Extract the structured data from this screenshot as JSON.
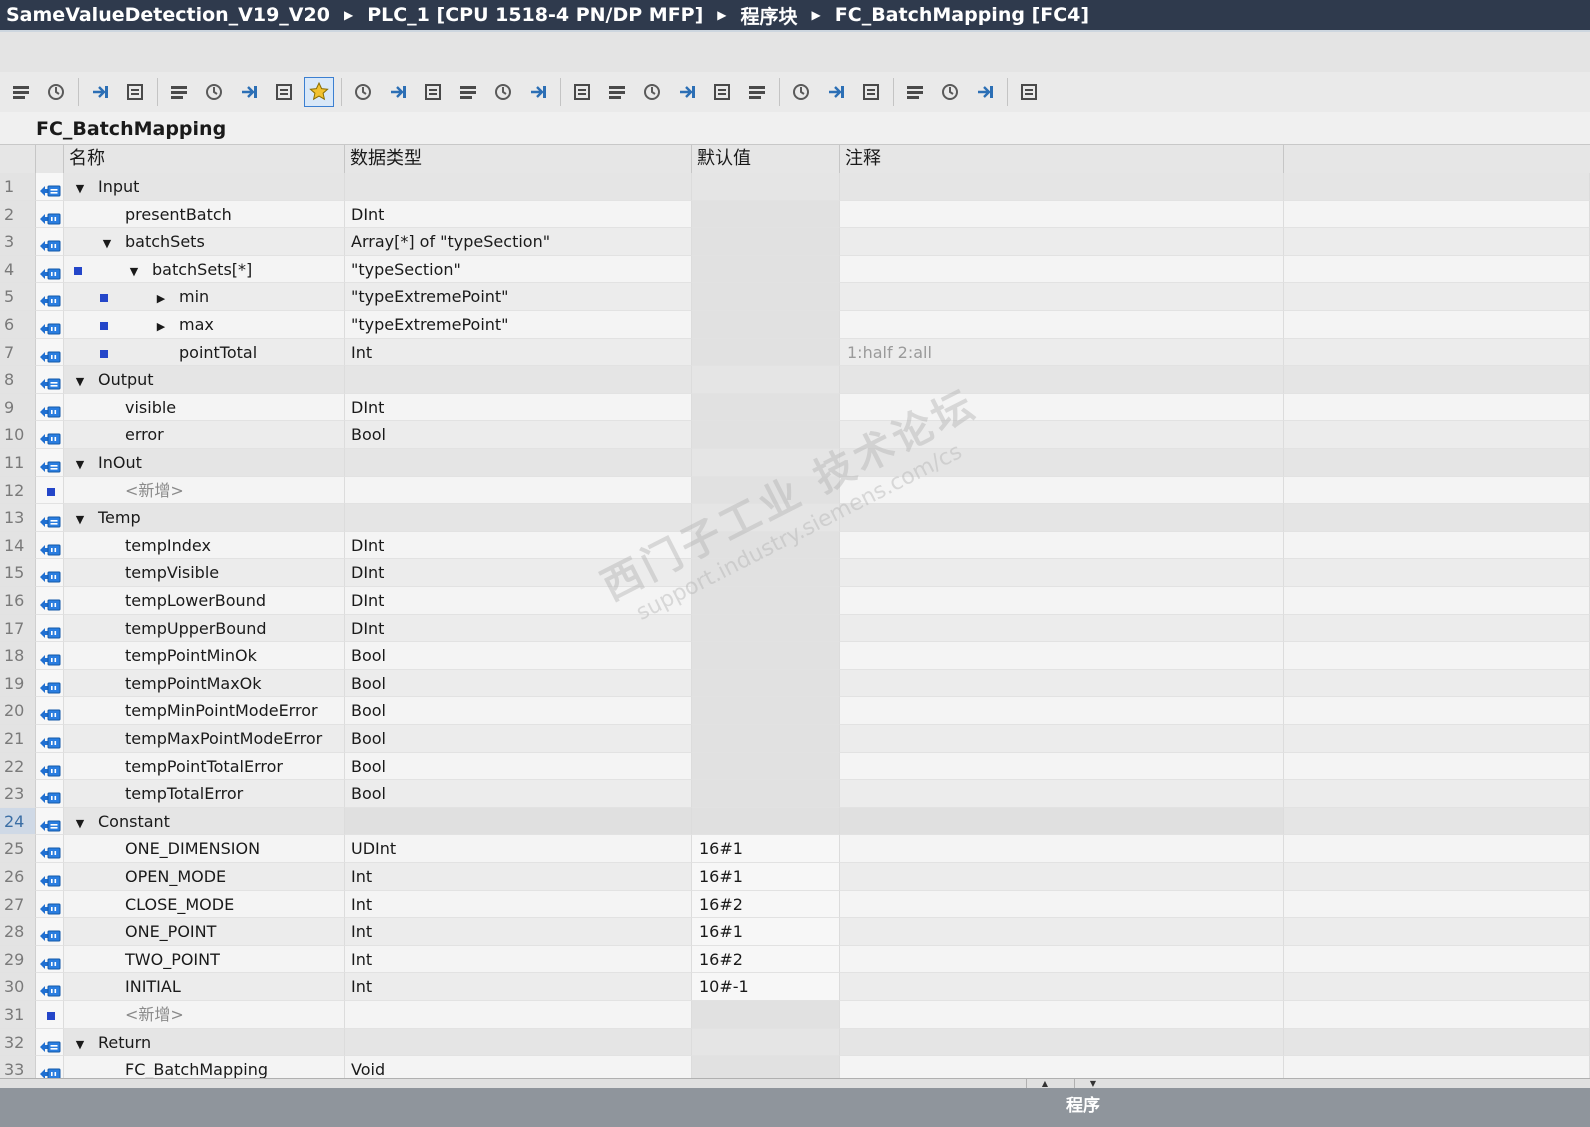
{
  "breadcrumb": [
    "SameValueDetection_V19_V20",
    "PLC_1 [CPU 1518-4 PN/DP MFP]",
    "程序块",
    "FC_BatchMapping [FC4]"
  ],
  "block_name": "FC_BatchMapping",
  "columns": {
    "name": "名称",
    "type": "数据类型",
    "default": "默认值",
    "comment": "注释"
  },
  "toolbar_icons": [
    "insert-row-icon",
    "add-row-icon",
    "expand-icon",
    "interface-icon",
    "monitor-icon",
    "list-icon",
    "list-edit-icon",
    "comment-icon",
    "favorites-icon",
    "call-icon",
    "call-step-icon",
    "jump-icon",
    "jump-back-icon",
    "align-icon",
    "network-icon",
    "move-left-icon",
    "indent-icon",
    "outdent-icon",
    "split-icon",
    "branch-icon",
    "branch-down-icon",
    "bookmark-icon",
    "undo-step-icon",
    "redo-step-icon",
    "search-icon",
    "monitor-glasses-icon",
    "compare-icon",
    "database-icon"
  ],
  "rows": [
    {
      "n": "1",
      "name": "Input",
      "type": "",
      "default": "",
      "comment": "",
      "level": 0,
      "expand": "open",
      "section": true,
      "mark": false
    },
    {
      "n": "2",
      "name": "presentBatch",
      "type": "DInt",
      "default": "",
      "comment": "",
      "level": 1,
      "expand": "none",
      "section": false,
      "mark": false
    },
    {
      "n": "3",
      "name": "batchSets",
      "type": "Array[*] of \"typeSection\"",
      "default": "",
      "comment": "",
      "level": 1,
      "expand": "open",
      "section": false,
      "mark": false
    },
    {
      "n": "4",
      "name": "batchSets[*]",
      "type": "\"typeSection\"",
      "default": "",
      "comment": "",
      "level": 2,
      "expand": "open",
      "section": false,
      "mark": true
    },
    {
      "n": "5",
      "name": "min",
      "type": "\"typeExtremePoint\"",
      "default": "",
      "comment": "",
      "level": 3,
      "expand": "closed",
      "section": false,
      "mark": true
    },
    {
      "n": "6",
      "name": "max",
      "type": "\"typeExtremePoint\"",
      "default": "",
      "comment": "",
      "level": 3,
      "expand": "closed",
      "section": false,
      "mark": true
    },
    {
      "n": "7",
      "name": "pointTotal",
      "type": "Int",
      "default": "",
      "comment": "1:half 2:all",
      "level": 3,
      "expand": "none",
      "section": false,
      "mark": true
    },
    {
      "n": "8",
      "name": "Output",
      "type": "",
      "default": "",
      "comment": "",
      "level": 0,
      "expand": "open",
      "section": true,
      "mark": false
    },
    {
      "n": "9",
      "name": "visible",
      "type": "DInt",
      "default": "",
      "comment": "",
      "level": 1,
      "expand": "none",
      "section": false,
      "mark": false
    },
    {
      "n": "10",
      "name": "error",
      "type": "Bool",
      "default": "",
      "comment": "",
      "level": 1,
      "expand": "none",
      "section": false,
      "mark": false
    },
    {
      "n": "11",
      "name": "InOut",
      "type": "",
      "default": "",
      "comment": "",
      "level": 0,
      "expand": "open",
      "section": true,
      "mark": false
    },
    {
      "n": "12",
      "name": "<新增>",
      "type": "",
      "default": "",
      "comment": "",
      "level": 1,
      "expand": "none",
      "section": false,
      "mark": false,
      "placeholder": true
    },
    {
      "n": "13",
      "name": "Temp",
      "type": "",
      "default": "",
      "comment": "",
      "level": 0,
      "expand": "open",
      "section": true,
      "mark": false
    },
    {
      "n": "14",
      "name": "tempIndex",
      "type": "DInt",
      "default": "",
      "comment": "",
      "level": 1,
      "expand": "none",
      "section": false,
      "mark": false
    },
    {
      "n": "15",
      "name": "tempVisible",
      "type": "DInt",
      "default": "",
      "comment": "",
      "level": 1,
      "expand": "none",
      "section": false,
      "mark": false
    },
    {
      "n": "16",
      "name": "tempLowerBound",
      "type": "DInt",
      "default": "",
      "comment": "",
      "level": 1,
      "expand": "none",
      "section": false,
      "mark": false
    },
    {
      "n": "17",
      "name": "tempUpperBound",
      "type": "DInt",
      "default": "",
      "comment": "",
      "level": 1,
      "expand": "none",
      "section": false,
      "mark": false
    },
    {
      "n": "18",
      "name": "tempPointMinOk",
      "type": "Bool",
      "default": "",
      "comment": "",
      "level": 1,
      "expand": "none",
      "section": false,
      "mark": false
    },
    {
      "n": "19",
      "name": "tempPointMaxOk",
      "type": "Bool",
      "default": "",
      "comment": "",
      "level": 1,
      "expand": "none",
      "section": false,
      "mark": false
    },
    {
      "n": "20",
      "name": "tempMinPointModeError",
      "type": "Bool",
      "default": "",
      "comment": "",
      "level": 1,
      "expand": "none",
      "section": false,
      "mark": false
    },
    {
      "n": "21",
      "name": "tempMaxPointModeError",
      "type": "Bool",
      "default": "",
      "comment": "",
      "level": 1,
      "expand": "none",
      "section": false,
      "mark": false
    },
    {
      "n": "22",
      "name": "tempPointTotalError",
      "type": "Bool",
      "default": "",
      "comment": "",
      "level": 1,
      "expand": "none",
      "section": false,
      "mark": false
    },
    {
      "n": "23",
      "name": "tempTotalError",
      "type": "Bool",
      "default": "",
      "comment": "",
      "level": 1,
      "expand": "none",
      "section": false,
      "mark": false
    },
    {
      "n": "24",
      "name": "Constant",
      "type": "",
      "default": "",
      "comment": "",
      "level": 0,
      "expand": "open",
      "section": true,
      "mark": false,
      "selected": true
    },
    {
      "n": "25",
      "name": "ONE_DIMENSION",
      "type": "UDInt",
      "default": "16#1",
      "comment": "",
      "level": 1,
      "expand": "none",
      "section": false,
      "mark": false,
      "const": true
    },
    {
      "n": "26",
      "name": "OPEN_MODE",
      "type": "Int",
      "default": "16#1",
      "comment": "",
      "level": 1,
      "expand": "none",
      "section": false,
      "mark": false,
      "const": true
    },
    {
      "n": "27",
      "name": "CLOSE_MODE",
      "type": "Int",
      "default": "16#2",
      "comment": "",
      "level": 1,
      "expand": "none",
      "section": false,
      "mark": false,
      "const": true
    },
    {
      "n": "28",
      "name": "ONE_POINT",
      "type": "Int",
      "default": "16#1",
      "comment": "",
      "level": 1,
      "expand": "none",
      "section": false,
      "mark": false,
      "const": true
    },
    {
      "n": "29",
      "name": "TWO_POINT",
      "type": "Int",
      "default": "16#2",
      "comment": "",
      "level": 1,
      "expand": "none",
      "section": false,
      "mark": false,
      "const": true
    },
    {
      "n": "30",
      "name": "INITIAL",
      "type": "Int",
      "default": "10#-1",
      "comment": "",
      "level": 1,
      "expand": "none",
      "section": false,
      "mark": false,
      "const": true
    },
    {
      "n": "31",
      "name": "<新增>",
      "type": "",
      "default": "",
      "comment": "",
      "level": 1,
      "expand": "none",
      "section": false,
      "mark": false,
      "placeholder": true
    },
    {
      "n": "32",
      "name": "Return",
      "type": "",
      "default": "",
      "comment": "",
      "level": 0,
      "expand": "open",
      "section": true,
      "mark": false
    },
    {
      "n": "33",
      "name": "FC_BatchMapping",
      "type": "Void",
      "default": "",
      "comment": "",
      "level": 1,
      "expand": "none",
      "section": false,
      "mark": false
    }
  ],
  "watermark": {
    "line1": "西门子工业 技术论坛",
    "line2": "support.industry.siemens.com/cs"
  },
  "status": {
    "label": "程序"
  },
  "colors": {
    "title_bg": "#2f3a4d",
    "marker": "#2446c9",
    "status_bg": "#8f959c"
  }
}
